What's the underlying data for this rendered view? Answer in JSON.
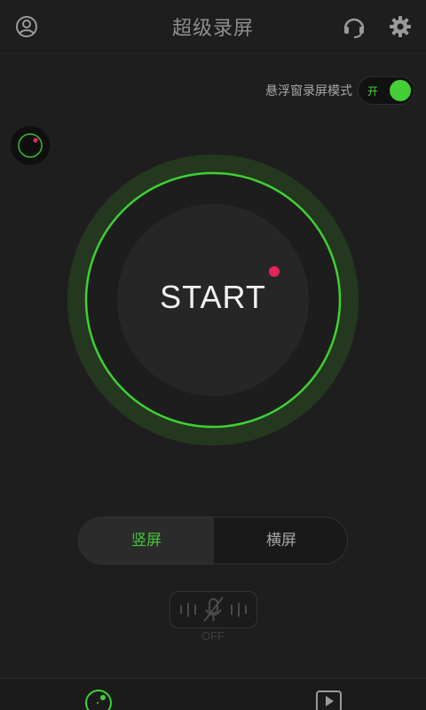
{
  "header": {
    "title": "超级录屏",
    "icons": [
      "user-icon",
      "headset-icon",
      "gear-icon"
    ]
  },
  "floating_mode": {
    "label": "悬浮窗录屏模式",
    "toggle_text": "开",
    "enabled": true
  },
  "start_button": {
    "label": "START"
  },
  "orientation": {
    "options": [
      "竖屏",
      "横屏"
    ],
    "selected": "竖屏"
  },
  "audio": {
    "status": "OFF",
    "icon": "microphone-muted-icon"
  },
  "bottom_nav": {
    "icons": [
      "record-icon",
      "video-list-icon"
    ]
  },
  "colors": {
    "accent": "#44cf37",
    "background": "#1e1e1e",
    "record_dot": "#e2245a"
  }
}
